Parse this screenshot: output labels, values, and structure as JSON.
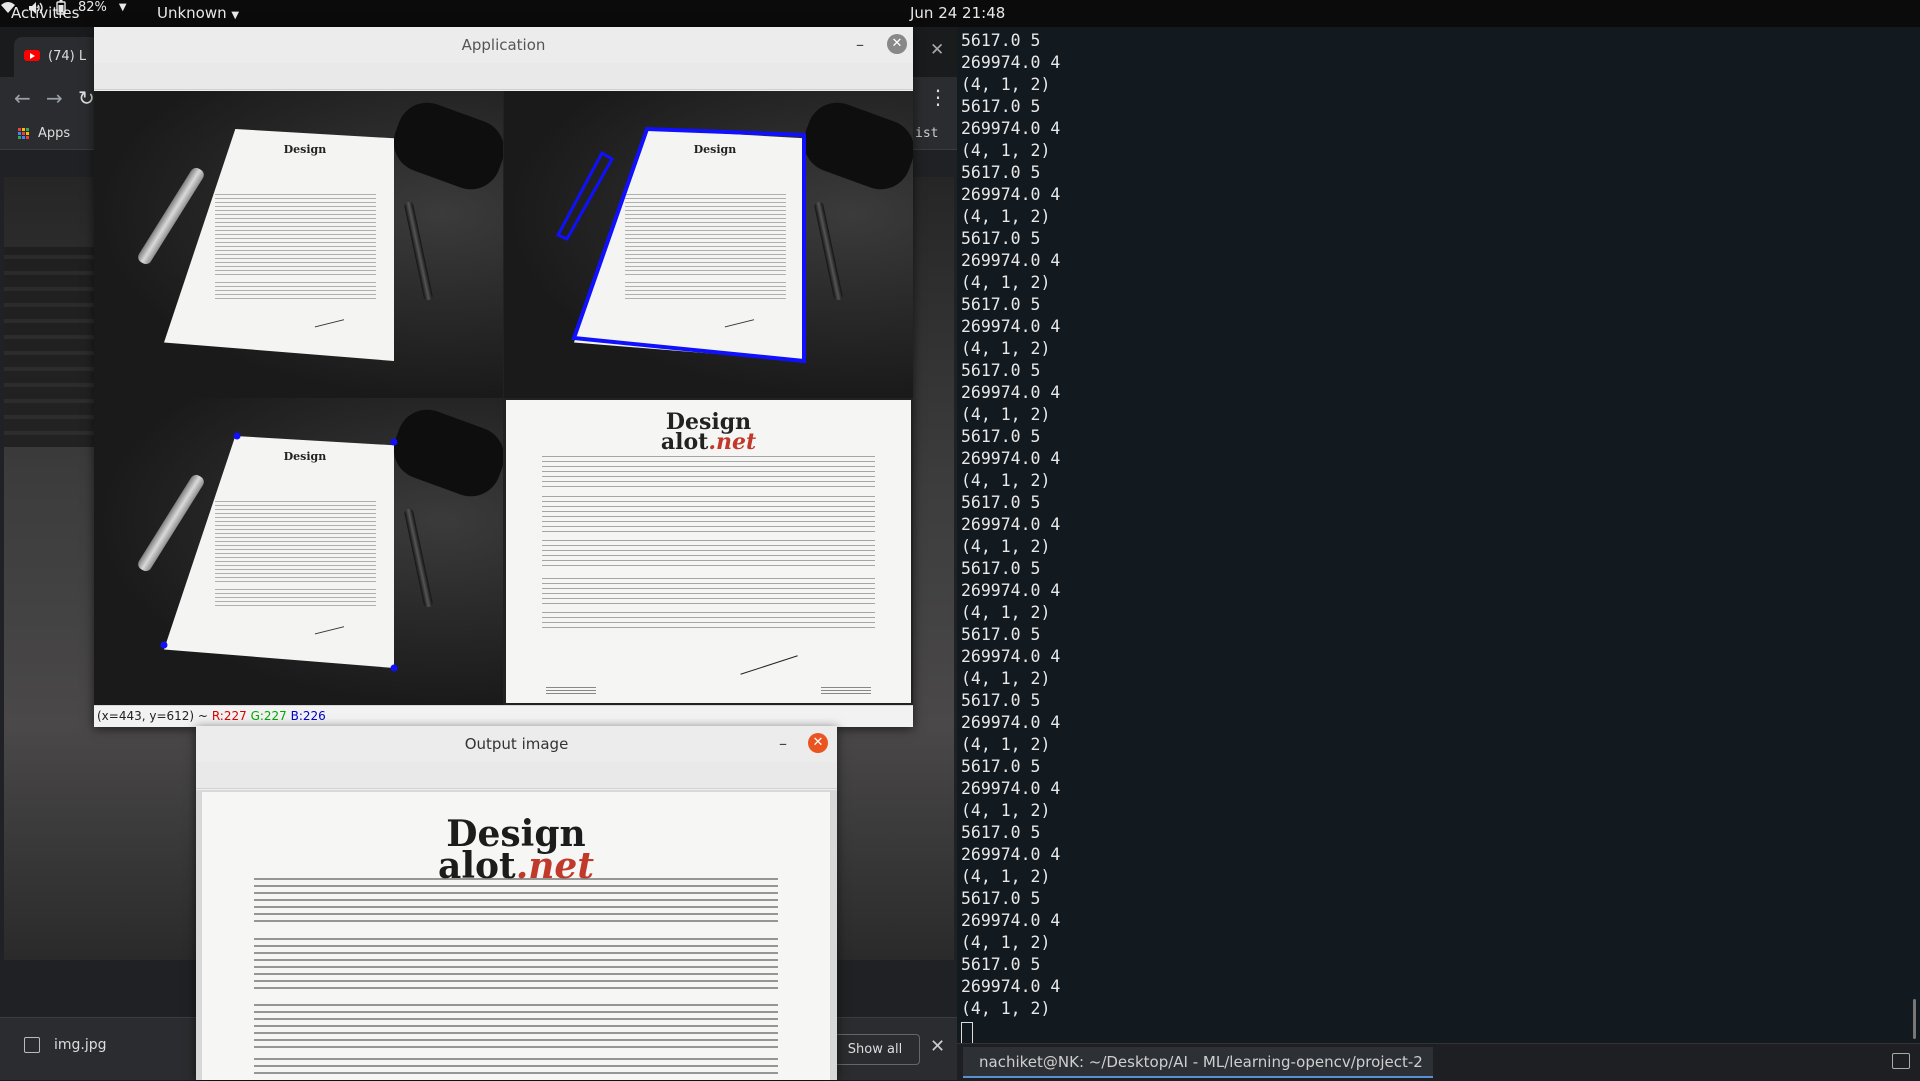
{
  "topbar": {
    "activities": "Activities",
    "app_menu": "Unknown",
    "clock": "Jun 24 21:48",
    "battery": "82%"
  },
  "browser": {
    "tab_title": "(74) L",
    "bookmarks_apps": "Apps",
    "bookmarks_right": "ist",
    "download_file": "img.jpg",
    "show_all": "Show all"
  },
  "app_window": {
    "title": "Application",
    "status_prefix": "(x=443, y=612) ~",
    "status_r": "R:227",
    "status_g": "G:227",
    "status_b": "B:226",
    "doc_logo_top": "Design",
    "doc_logo_bottom": "alot",
    "doc_logo_net": ".net"
  },
  "output_window": {
    "title": "Output image",
    "doc_logo_top": "Design",
    "doc_logo_bottom": "alot",
    "doc_logo_net": ".net"
  },
  "terminal": {
    "lines": [
      "5617.0 5",
      "269974.0 4",
      "(4, 1, 2)",
      "5617.0 5",
      "269974.0 4",
      "(4, 1, 2)",
      "5617.0 5",
      "269974.0 4",
      "(4, 1, 2)",
      "5617.0 5",
      "269974.0 4",
      "(4, 1, 2)",
      "5617.0 5",
      "269974.0 4",
      "(4, 1, 2)",
      "5617.0 5",
      "269974.0 4",
      "(4, 1, 2)",
      "5617.0 5",
      "269974.0 4",
      "(4, 1, 2)",
      "5617.0 5",
      "269974.0 4",
      "(4, 1, 2)",
      "5617.0 5",
      "269974.0 4",
      "(4, 1, 2)",
      "5617.0 5",
      "269974.0 4",
      "(4, 1, 2)",
      "5617.0 5",
      "269974.0 4",
      "(4, 1, 2)",
      "5617.0 5",
      "269974.0 4",
      "(4, 1, 2)",
      "5617.0 5",
      "269974.0 4",
      "(4, 1, 2)",
      "5617.0 5",
      "269974.0 4",
      "(4, 1, 2)",
      "5617.0 5",
      "269974.0 4",
      "(4, 1, 2)"
    ],
    "task_title": "nachiket@NK: ~/Desktop/AI - ML/learning-opencv/project-2"
  },
  "colors": {
    "contour_blue": "#1010ff",
    "ubuntu_orange": "#e95420",
    "terminal_bg": "#12191f"
  }
}
